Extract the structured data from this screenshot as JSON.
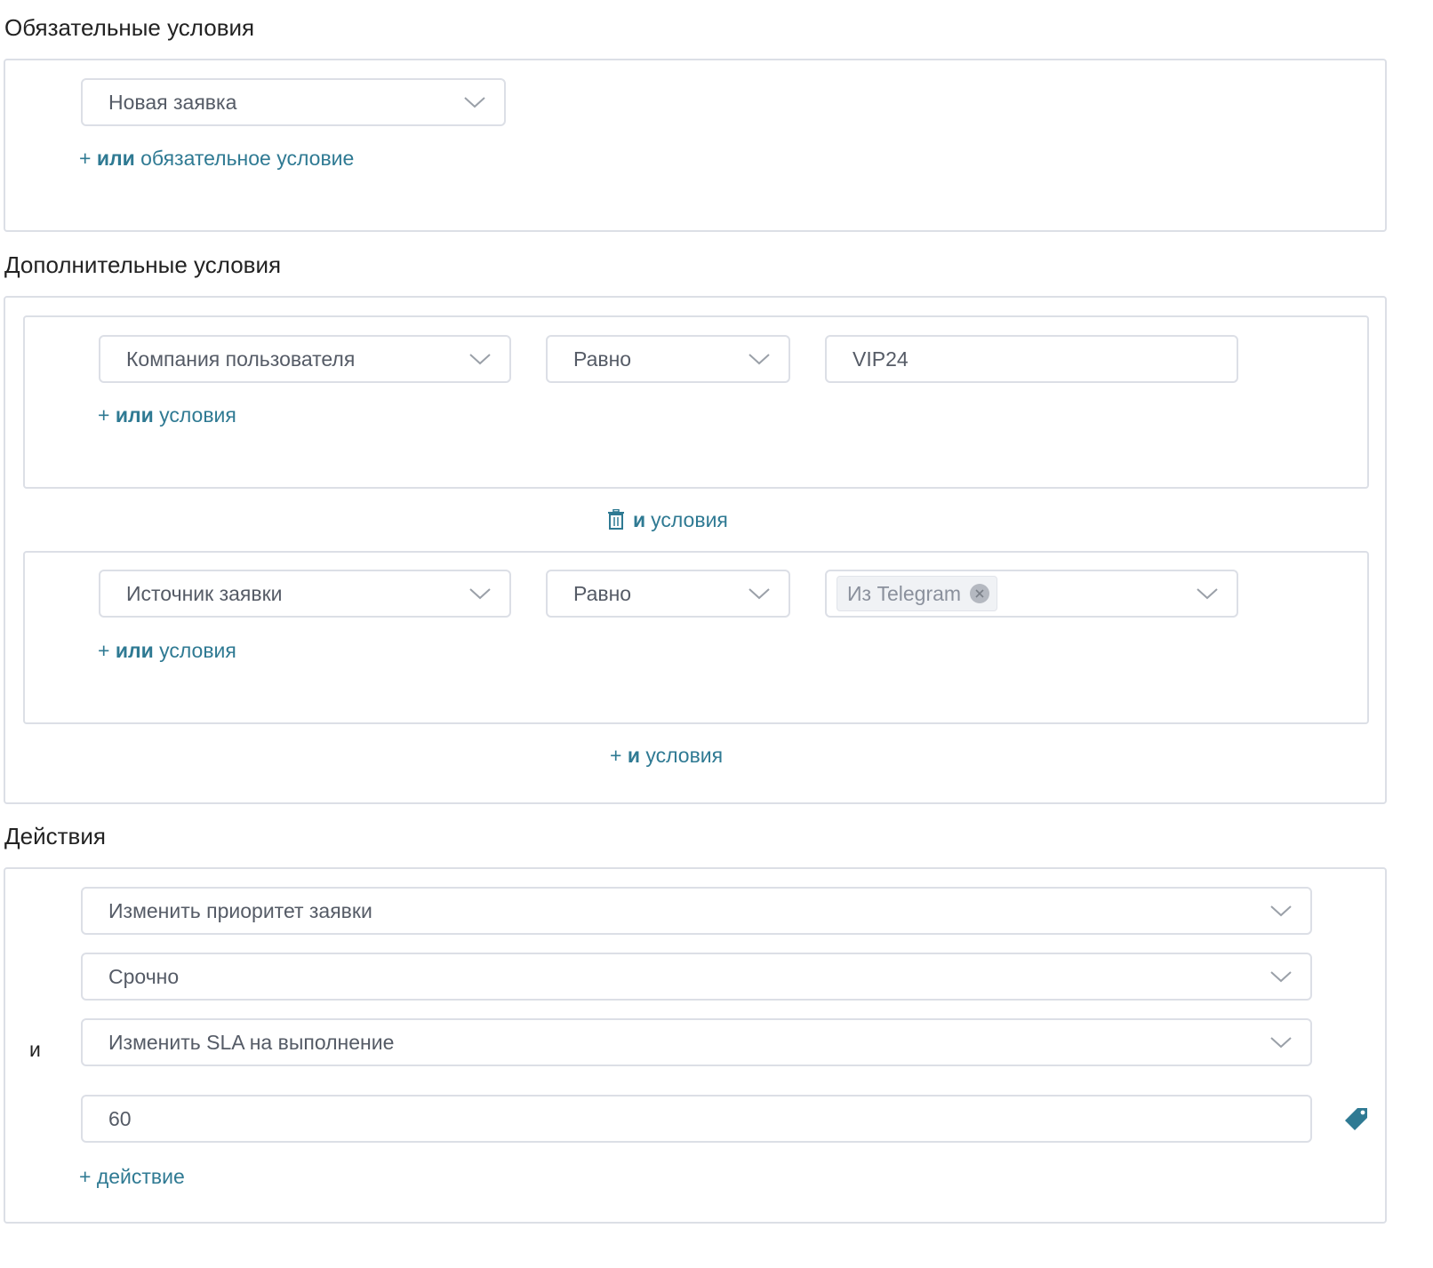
{
  "required": {
    "title": "Обязательные условия",
    "condition_value": "Новая заявка",
    "add_or": {
      "plus": "+",
      "bold": "или",
      "rest": "обязательное условие"
    }
  },
  "additional": {
    "title": "Дополнительные условия",
    "groups": [
      {
        "field": "Компания пользователя",
        "operator": "Равно",
        "value": "VIP24",
        "add_or": {
          "plus": "+",
          "bold": "или",
          "rest": "условия"
        }
      },
      {
        "field": "Источник заявки",
        "operator": "Равно",
        "tag": "Из Telegram",
        "add_or": {
          "plus": "+",
          "bold": "или",
          "rest": "условия"
        }
      }
    ],
    "delete_and": {
      "bold": "и",
      "rest": "условия"
    },
    "add_and": {
      "plus": "+",
      "bold": "и",
      "rest": "условия"
    }
  },
  "actions": {
    "title": "Действия",
    "and_label": "и",
    "action1": "Изменить приоритет заявки",
    "action1_value": "Срочно",
    "action2": "Изменить SLA на выполнение",
    "action2_value": "60",
    "add_action": "+ действие"
  },
  "colors": {
    "accent": "#2f7a93",
    "border": "#dcdfe6",
    "text": "#555b66"
  },
  "icons": {
    "dropdown": "chevron-down-icon",
    "delete": "trash-icon",
    "tag": "tag-icon",
    "tag_remove": "close-icon"
  }
}
